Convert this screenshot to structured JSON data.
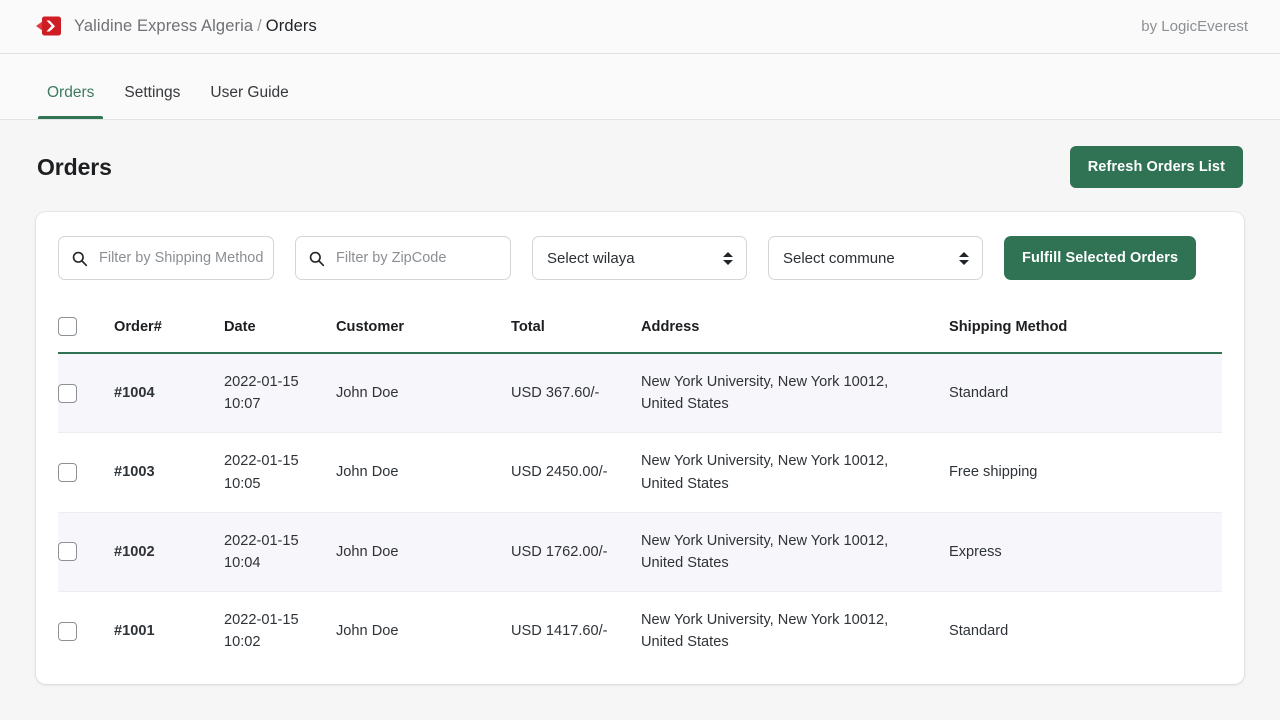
{
  "topbar": {
    "logo_icon": "yalidine-logo-icon",
    "app_name": "Yalidine Express Algeria",
    "separator": "/",
    "current_section": "Orders",
    "byline": "by LogicEverest"
  },
  "tabs": [
    {
      "label": "Orders",
      "active": true
    },
    {
      "label": "Settings",
      "active": false
    },
    {
      "label": "User Guide",
      "active": false
    }
  ],
  "page": {
    "title": "Orders",
    "refresh_button": "Refresh Orders List"
  },
  "filters": {
    "shipping_method": {
      "placeholder": "Filter by Shipping Method",
      "value": "",
      "icon": "search-icon"
    },
    "zipcode": {
      "placeholder": "Filter by ZipCode",
      "value": "",
      "icon": "search-icon"
    },
    "wilaya": {
      "selected": "Select wilaya",
      "icon": "stepper-icon"
    },
    "commune": {
      "selected": "Select commune",
      "icon": "stepper-icon"
    },
    "fulfill_button": "Fulfill Selected Orders"
  },
  "table": {
    "columns": [
      "",
      "Order#",
      "Date",
      "Customer",
      "Total",
      "Address",
      "Shipping Method"
    ],
    "rows": [
      {
        "order": "#1004",
        "date": "2022-01-15\n10:07",
        "customer": "John Doe",
        "total": "USD 367.60/-",
        "address": "New York University, New York 10012,\nUnited States",
        "shipping": "Standard",
        "checked": false
      },
      {
        "order": "#1003",
        "date": "2022-01-15\n10:05",
        "customer": "John Doe",
        "total": "USD 2450.00/-",
        "address": "New York University, New York 10012,\nUnited States",
        "shipping": "Free shipping",
        "checked": false
      },
      {
        "order": "#1002",
        "date": "2022-01-15\n10:04",
        "customer": "John Doe",
        "total": "USD 1762.00/-",
        "address": "New York University, New York 10012,\nUnited States",
        "shipping": "Express",
        "checked": false
      },
      {
        "order": "#1001",
        "date": "2022-01-15\n10:02",
        "customer": "John Doe",
        "total": "USD 1417.60/-",
        "address": "New York University, New York 10012,\nUnited States",
        "shipping": "Standard",
        "checked": false
      }
    ]
  },
  "colors": {
    "brand_green": "#2f7354",
    "tab_active": "#317554",
    "logo_red": "#d8232a",
    "row_alt": "#f7f6fb",
    "page_bg": "#f6f6f7"
  }
}
